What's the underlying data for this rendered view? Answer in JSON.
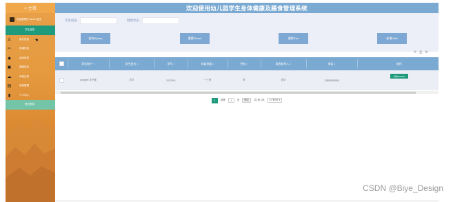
{
  "sidebar": {
    "logo_icon": "home-icon",
    "logo_text": "主页",
    "user_text": "欢迎管理员 admin 退出",
    "menu": [
      {
        "label": "学生信息",
        "icon": "",
        "state": "active"
      },
      {
        "label": "家长信息",
        "icon": "person-icon",
        "state": ""
      },
      {
        "label": "食谱信息",
        "icon": "utensils-icon",
        "state": ""
      },
      {
        "label": "运动信息",
        "icon": "tag-icon",
        "state": ""
      },
      {
        "label": "健康信息",
        "icon": "chart-icon",
        "state": ""
      },
      {
        "label": "体检记录",
        "icon": "cloud-icon",
        "state": ""
      },
      {
        "label": "系统管理",
        "icon": "save-icon",
        "state": ""
      },
      {
        "label": "个人中心",
        "icon": "book-icon",
        "state": ""
      },
      {
        "label": "退出登录",
        "icon": "",
        "state": "light"
      }
    ]
  },
  "header": {
    "title": "欢迎使用幼儿园学生身体健康及膳食管理系统"
  },
  "search": {
    "field1_label": "学生姓名",
    "field1_value": "",
    "field2_label": "健康状态",
    "field2_value": ""
  },
  "buttons": {
    "query": "查询/Query",
    "reset": "重置/Reset",
    "delete": "删除/Del",
    "add": "新增/Add"
  },
  "toolbar": {
    "icons": [
      "refresh-icon",
      "print-icon",
      "settings-icon"
    ]
  },
  "table": {
    "headers": [
      "家长账户",
      "学生姓名",
      "学号",
      "年级班级",
      "性别",
      "紧急联系人",
      "电话",
      "操作"
    ],
    "rows": [
      {
        "cells": [
          "yangbei 羊子墨 ",
          "羊羊",
          "2023001",
          "一三班",
          "男",
          "张华",
          "13888888888"
        ],
        "action": "详情/Details"
      }
    ]
  },
  "pager": {
    "current": "1",
    "goto_label": "到第",
    "goto_value": "1",
    "page_label": "页",
    "go_label": "确定",
    "total_text": "共1条 1页",
    "page_size": "10 条/页 ▾"
  },
  "colors": {
    "header_bg": "#7aa9d2",
    "button_bg": "#7ea8d4",
    "accent_green": "#1f9a7d",
    "sidebar_orange": "#e59a3f"
  },
  "watermark": "CSDN @Biye_Design"
}
